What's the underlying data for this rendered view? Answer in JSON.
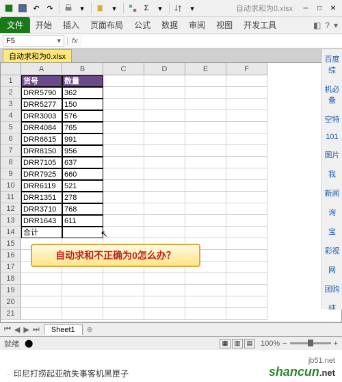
{
  "quickAccess": {
    "filename": "自动求和为0.xlsx"
  },
  "ribbon": {
    "fileTab": "文件",
    "tabs": [
      "开始",
      "插入",
      "页面布局",
      "公式",
      "数据",
      "审阅",
      "视图",
      "开发工具"
    ]
  },
  "nameBox": "F5",
  "formulaBarLabel": "fx",
  "docTab": "自动求和为0.xlsx",
  "columns": [
    "A",
    "B",
    "C",
    "D",
    "E",
    "F"
  ],
  "headerRow": [
    "货号",
    "数量"
  ],
  "dataRows": [
    [
      "DRR5790",
      "362"
    ],
    [
      "DRR5277",
      "150"
    ],
    [
      "DRR3003",
      "576"
    ],
    [
      "DRR4084",
      "765"
    ],
    [
      "DRR6615",
      "991"
    ],
    [
      "DRR8150",
      "956"
    ],
    [
      "DRR7105",
      "637"
    ],
    [
      "DRR7925",
      "660"
    ],
    [
      "DRR6119",
      "521"
    ],
    [
      "DRR1351",
      "278"
    ],
    [
      "DRR3710",
      "768"
    ],
    [
      "DRR1643",
      "611"
    ]
  ],
  "totalLabel": "合计",
  "callout": "自动求和不正确为0怎么办？",
  "sheetTab": "Sheet1",
  "statusBar": {
    "ready": "就绪",
    "zoom": "100%"
  },
  "bottomText": "印尼打捞起亚航失事客机黑匣子",
  "logo": {
    "main": "shancun",
    "ext": ".net",
    "sub": "jb51.net"
  },
  "rightLinks": [
    "百度综",
    "机必备",
    "空特",
    "101",
    "图片",
    "我",
    "新闻",
    "询",
    "宝",
    "彩视",
    "网",
    "团购",
    "纯"
  ]
}
